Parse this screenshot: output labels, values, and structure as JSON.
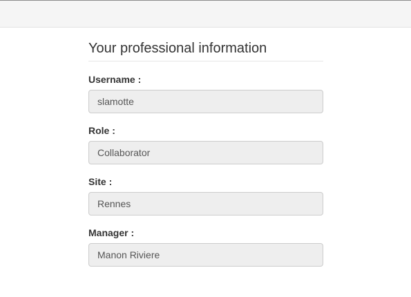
{
  "section": {
    "title": "Your professional information"
  },
  "fields": [
    {
      "label": "Username :",
      "value": "slamotte"
    },
    {
      "label": "Role :",
      "value": "Collaborator"
    },
    {
      "label": "Site :",
      "value": "Rennes"
    },
    {
      "label": "Manager :",
      "value": "Manon Riviere"
    }
  ]
}
